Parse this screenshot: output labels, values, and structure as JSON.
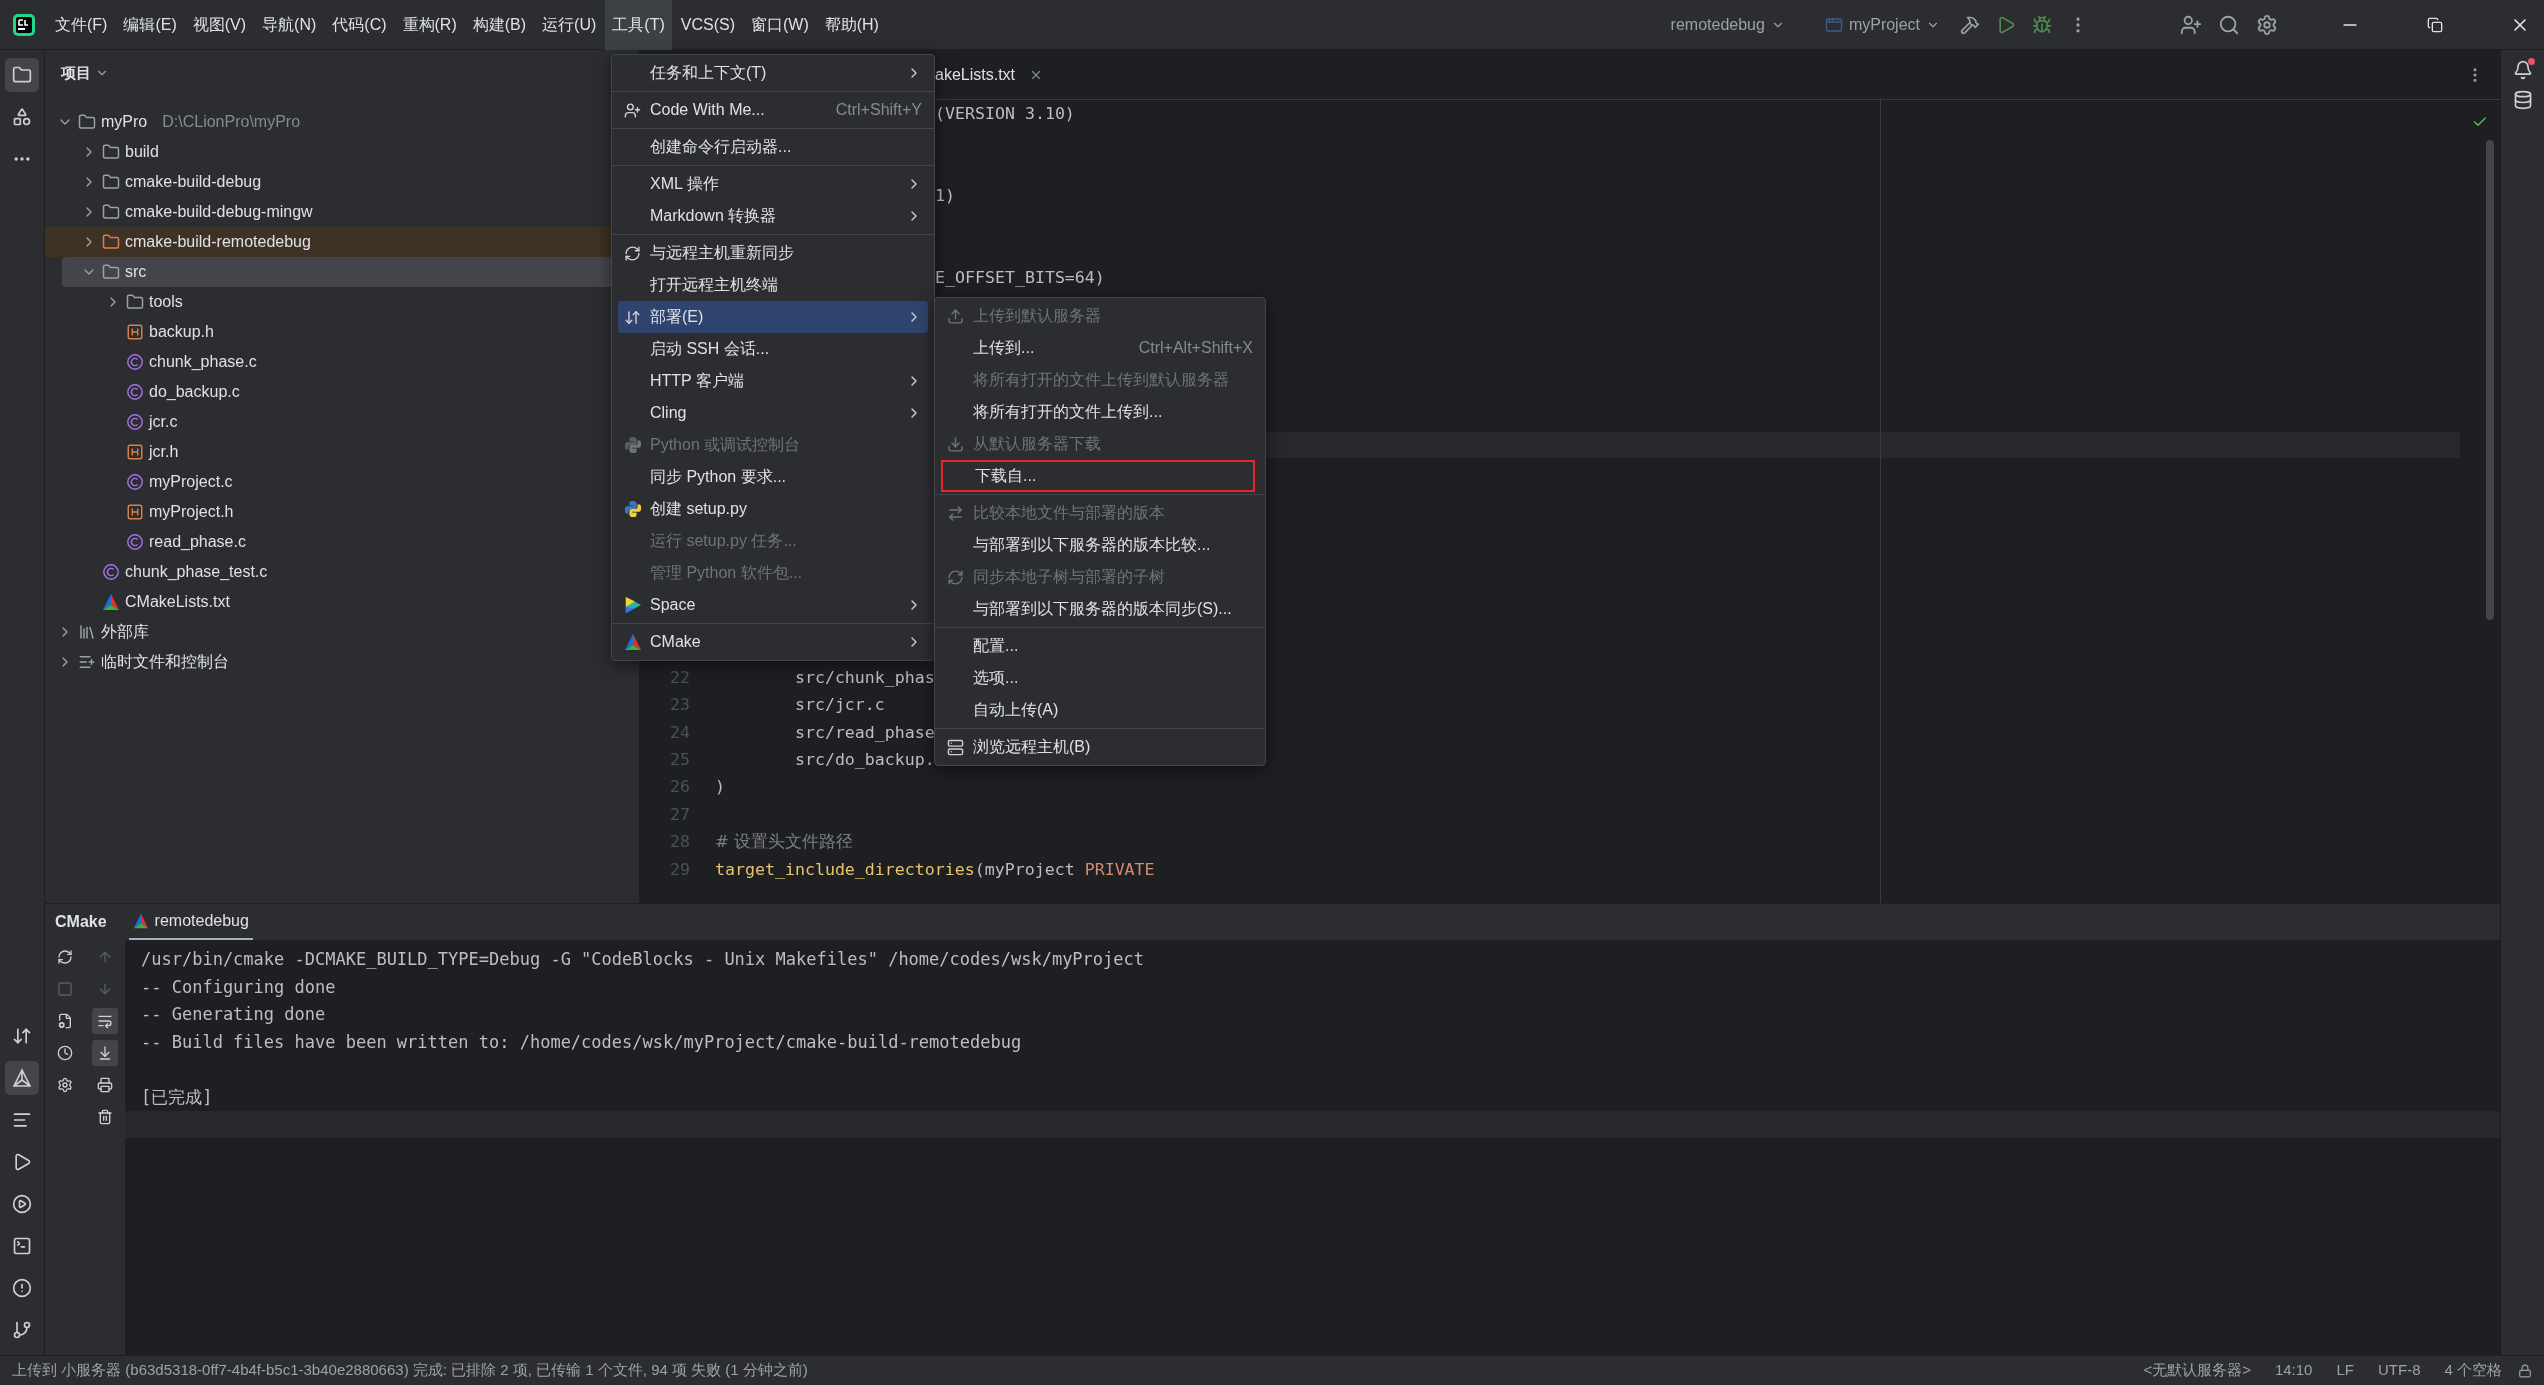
{
  "title_bar": {
    "menus": [
      {
        "label": "文件(F)",
        "selected": false
      },
      {
        "label": "编辑(E)",
        "selected": false
      },
      {
        "label": "视图(V)",
        "selected": false
      },
      {
        "label": "导航(N)",
        "selected": false
      },
      {
        "label": "代码(C)",
        "selected": false
      },
      {
        "label": "重构(R)",
        "selected": false
      },
      {
        "label": "构建(B)",
        "selected": false
      },
      {
        "label": "运行(U)",
        "selected": false
      },
      {
        "label": "工具(T)",
        "selected": true
      },
      {
        "label": "VCS(S)",
        "selected": false
      },
      {
        "label": "窗口(W)",
        "selected": false
      },
      {
        "label": "帮助(H)",
        "selected": false
      }
    ],
    "run_config": "remotedebug",
    "project": "myProject"
  },
  "project_panel": {
    "title": "项目",
    "tree": [
      {
        "label": "myPro",
        "path": "D:\\CLionPro\\myPro",
        "kind": "project",
        "expanded": true,
        "selected": false,
        "excluded": false,
        "children": [
          {
            "label": "build",
            "kind": "folder",
            "expanded": false,
            "selected": false,
            "excluded": false
          },
          {
            "label": "cmake-build-debug",
            "kind": "folder",
            "expanded": false,
            "selected": false,
            "excluded": false
          },
          {
            "label": "cmake-build-debug-mingw",
            "kind": "folder",
            "expanded": false,
            "selected": false,
            "excluded": false
          },
          {
            "label": "cmake-build-remotedebug",
            "kind": "folder",
            "expanded": false,
            "selected": false,
            "excluded": true
          },
          {
            "label": "src",
            "kind": "folder",
            "expanded": true,
            "selected": true,
            "excluded": false,
            "children": [
              {
                "label": "tools",
                "kind": "folder",
                "expanded": false,
                "selected": false,
                "excluded": false
              },
              {
                "label": "backup.h",
                "kind": "header",
                "selected": false,
                "excluded": false
              },
              {
                "label": "chunk_phase.c",
                "kind": "source",
                "selected": false,
                "excluded": false
              },
              {
                "label": "do_backup.c",
                "kind": "source",
                "selected": false,
                "excluded": false
              },
              {
                "label": "jcr.c",
                "kind": "source",
                "selected": false,
                "excluded": false
              },
              {
                "label": "jcr.h",
                "kind": "header",
                "selected": false,
                "excluded": false
              },
              {
                "label": "myProject.c",
                "kind": "source",
                "selected": false,
                "excluded": false
              },
              {
                "label": "myProject.h",
                "kind": "header",
                "selected": false,
                "excluded": false
              },
              {
                "label": "read_phase.c",
                "kind": "source",
                "selected": false,
                "excluded": false
              }
            ]
          },
          {
            "label": "chunk_phase_test.c",
            "kind": "source",
            "selected": false,
            "excluded": false
          },
          {
            "label": "CMakeLists.txt",
            "kind": "cmake",
            "selected": false,
            "excluded": false
          }
        ]
      },
      {
        "label": "外部库",
        "kind": "library",
        "expanded": false,
        "selected": false,
        "excluded": false
      },
      {
        "label": "临时文件和控制台",
        "kind": "scratch",
        "expanded": false,
        "selected": false,
        "excluded": false
      }
    ]
  },
  "editor": {
    "tab": {
      "label": "akeLists.txt"
    },
    "fragments": [
      "(VERSION 3.10)",
      "1)",
      "E_OFFSET_BITS=64)"
    ],
    "lines": [
      {
        "number": "22",
        "tokens": [
          {
            "text": "        src/chunk_phas",
            "kind": "plain"
          }
        ]
      },
      {
        "number": "23",
        "tokens": [
          {
            "text": "        src/jcr.c",
            "kind": "plain"
          }
        ]
      },
      {
        "number": "24",
        "tokens": [
          {
            "text": "        src/read_phase",
            "kind": "plain"
          }
        ]
      },
      {
        "number": "25",
        "tokens": [
          {
            "text": "        src/do_backup.",
            "kind": "plain"
          }
        ]
      },
      {
        "number": "26",
        "tokens": [
          {
            "text": ")",
            "kind": "plain"
          }
        ]
      },
      {
        "number": "27"
      },
      {
        "number": "28",
        "tokens": [
          {
            "text": "# 设置头文件路径",
            "kind": "comment"
          }
        ]
      },
      {
        "number": "29",
        "tokens": [
          {
            "text": "target_include_directories",
            "kind": "function"
          },
          {
            "text": "(myProject ",
            "kind": "plain"
          },
          {
            "text": "PRIVATE",
            "kind": "keyword"
          }
        ]
      }
    ]
  },
  "tools_menu": {
    "groups": [
      [
        {
          "label": "任务和上下文(T)",
          "submenu": true,
          "disabled": false,
          "selected": false
        }
      ],
      [
        {
          "label": "Code With Me...",
          "shortcut": "Ctrl+Shift+Y",
          "submenu": false,
          "disabled": false,
          "selected": false
        }
      ],
      [
        {
          "label": "创建命令行启动器...",
          "submenu": false,
          "disabled": false,
          "selected": false
        }
      ],
      [
        {
          "label": "XML 操作",
          "submenu": true,
          "disabled": false,
          "selected": false
        },
        {
          "label": "Markdown 转换器",
          "submenu": true,
          "disabled": false,
          "selected": false
        }
      ],
      [
        {
          "label": "与远程主机重新同步",
          "submenu": false,
          "disabled": false,
          "selected": false
        },
        {
          "label": "打开远程主机终端",
          "submenu": false,
          "disabled": false,
          "selected": false
        },
        {
          "label": "部署(E)",
          "submenu": true,
          "disabled": false,
          "selected": true
        },
        {
          "label": "启动 SSH 会话...",
          "submenu": false,
          "disabled": false,
          "selected": false
        },
        {
          "label": "HTTP 客户端",
          "submenu": true,
          "disabled": false,
          "selected": false
        },
        {
          "label": "Cling",
          "submenu": true,
          "disabled": false,
          "selected": false
        },
        {
          "label": "Python 或调试控制台",
          "submenu": false,
          "disabled": true,
          "selected": false
        },
        {
          "label": "同步 Python 要求...",
          "submenu": false,
          "disabled": false,
          "selected": false
        },
        {
          "label": "创建 setup.py",
          "submenu": false,
          "disabled": false,
          "selected": false
        },
        {
          "label": "运行 setup.py 任务...",
          "submenu": false,
          "disabled": true,
          "selected": false
        },
        {
          "label": "管理 Python 软件包...",
          "submenu": false,
          "disabled": true,
          "selected": false
        },
        {
          "label": "Space",
          "submenu": true,
          "disabled": false,
          "selected": false
        }
      ],
      [
        {
          "label": "CMake",
          "submenu": true,
          "disabled": false,
          "selected": false
        }
      ]
    ]
  },
  "deployment_menu": {
    "groups": [
      [
        {
          "label": "上传到默认服务器",
          "disabled": true,
          "outlined": false
        },
        {
          "label": "上传到...",
          "shortcut": "Ctrl+Alt+Shift+X",
          "disabled": false,
          "outlined": false
        },
        {
          "label": "将所有打开的文件上传到默认服务器",
          "disabled": true,
          "outlined": false
        },
        {
          "label": "将所有打开的文件上传到...",
          "disabled": false,
          "outlined": false
        },
        {
          "label": "从默认服务器下载",
          "disabled": true,
          "outlined": false
        },
        {
          "label": "下载自...",
          "disabled": false,
          "outlined": true
        }
      ],
      [
        {
          "label": "比较本地文件与部署的版本",
          "disabled": true,
          "outlined": false
        },
        {
          "label": "与部署到以下服务器的版本比较...",
          "disabled": false,
          "outlined": false
        },
        {
          "label": "同步本地子树与部署的子树",
          "disabled": true,
          "outlined": false
        },
        {
          "label": "与部署到以下服务器的版本同步(S)...",
          "disabled": false,
          "outlined": false
        }
      ],
      [
        {
          "label": "配置...",
          "disabled": false,
          "outlined": false
        },
        {
          "label": "选项...",
          "disabled": false,
          "outlined": false
        },
        {
          "label": "自动上传(A)",
          "disabled": false,
          "outlined": false
        }
      ],
      [
        {
          "label": "浏览远程主机(B)",
          "disabled": false,
          "outlined": false
        }
      ]
    ]
  },
  "bottom_panel": {
    "title": "CMake",
    "tabs": [
      {
        "label": "remotedebug",
        "selected": true
      }
    ],
    "output": [
      [
        "/usr/bin/cmake -DCMAKE_BUILD_TYPE=Debug -G \"CodeBlocks - Unix Makefiles\" /home/codes/wsk/myProject",
        "-- Configuring done",
        "-- Generating done",
        "-- Build files have been written to: /home/codes/wsk/myProject/cmake-build-remotedebug"
      ],
      [
        "[已完成]"
      ]
    ]
  },
  "status_bar": {
    "message": "上传到 小服务器 (b63d5318-0ff7-4b4f-b5c1-3b40e2880663) 完成: 已排除 2 项, 已传输 1 个文件, 94 项 失败 (1 分钟之前)",
    "items": [
      "<无默认服务器>",
      "14:10",
      "LF",
      "UTF-8",
      "4 个空格"
    ]
  }
}
